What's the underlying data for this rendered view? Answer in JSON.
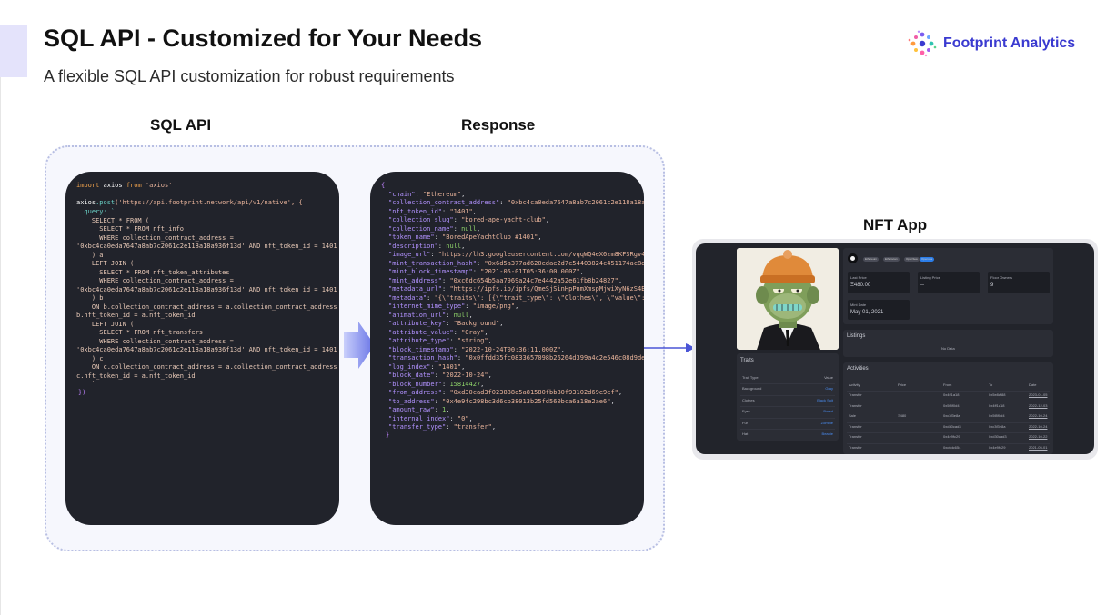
{
  "header": {
    "title": "SQL API - Customized for Your Needs",
    "subtitle": "A flexible SQL API customization for robust requirements"
  },
  "brand": {
    "name": "Footprint Analytics",
    "color": "#3a3ad0"
  },
  "columns": {
    "sql": "SQL API",
    "response": "Response",
    "app": "NFT App"
  },
  "code": {
    "import": {
      "kw1": "import",
      "name": "axios",
      "kw2": "from",
      "str": "'axios'"
    },
    "call": {
      "obj": "axios",
      "method": ".post",
      "url": "('https://api.footprint.network/api/v1/native', {"
    },
    "query_key": "  query: `",
    "sql_lines": [
      "    SELECT * FROM (",
      "      SELECT * FROM nft_info",
      "      WHERE collection_contract_address =",
      "'0xbc4ca0eda7647a8ab7c2061c2e118a18a936f13d' AND nft_token_id = 1401",
      "    ) a",
      "    LEFT JOIN (",
      "      SELECT * FROM nft_token_attributes",
      "      WHERE collection_contract_address =",
      "'0xbc4ca0eda7647a8ab7c2061c2e118a18a936f13d' AND nft_token_id = 1401",
      "    ) b",
      "    ON b.collection_contract_address = a.collection_contract_address AND",
      "b.nft_token_id = a.nft_token_id",
      "    LEFT JOIN (",
      "      SELECT * FROM nft_transfers",
      "      WHERE collection_contract_address =",
      "'0xbc4ca0eda7647a8ab7c2061c2e118a18a936f13d' AND nft_token_id = 1401",
      "    ) c",
      "    ON c.collection_contract_address = a.collection_contract_address AND",
      "c.nft_token_id = a.nft_token_id",
      "    `"
    ],
    "close": "})"
  },
  "response": {
    "open": "{",
    "close": "}",
    "rows": [
      {
        "key": "\"chain\"",
        "val": "\"Ethereum\"",
        "type": "str"
      },
      {
        "key": "\"collection_contract_address\"",
        "val": "\"0xbc4ca0eda7647a8ab7c2061c2e118a18a936f",
        "type": "str"
      },
      {
        "key": "\"nft_token_id\"",
        "val": "\"1401\"",
        "type": "str"
      },
      {
        "key": "\"collection_slug\"",
        "val": "\"bored-ape-yacht-club\"",
        "type": "str"
      },
      {
        "key": "\"collection_name\"",
        "val": "null",
        "type": "num"
      },
      {
        "key": "\"token_name\"",
        "val": "\"BoredApeYachtClub #1401\"",
        "type": "str"
      },
      {
        "key": "\"description\"",
        "val": "null",
        "type": "num"
      },
      {
        "key": "\"image_url\"",
        "val": "\"https://lh3.googleusercontent.com/vqqWQ4eX6zm8KFSRgv4-K6",
        "type": "str"
      },
      {
        "key": "\"mint_transaction_hash\"",
        "val": "\"0x6d5a377ad620edae2d7c54403824c451174ac8dd",
        "type": "str"
      },
      {
        "key": "\"mint_block_timestamp\"",
        "val": "\"2021-05-01T05:36:00.000Z\"",
        "type": "str"
      },
      {
        "key": "\"mint_address\"",
        "val": "\"0xc6dc654b5aa7969a24c7e4442a52e61fb8b24827\"",
        "type": "str"
      },
      {
        "key": "\"metadata_url\"",
        "val": "\"https://ipfs.io/ipfs/QmeSjSinHpPnmXmspMjwiXyN6zS4E9zcca",
        "type": "str"
      },
      {
        "key": "\"metadata\"",
        "val": "\"{\\\"traits\\\": [{\\\"trait_type\\\": \\\"Clothes\\\", \\\"value\\\": \\\"Black Suit\\\"",
        "type": "str"
      },
      {
        "key": "\"internet_mime_type\"",
        "val": "\"image/png\"",
        "type": "str"
      },
      {
        "key": "\"animation_url\"",
        "val": "null",
        "type": "num"
      },
      {
        "key": "\"attribute_key\"",
        "val": "\"Background\"",
        "type": "str"
      },
      {
        "key": "\"attribute_value\"",
        "val": "\"Gray\"",
        "type": "str"
      },
      {
        "key": "\"attribute_type\"",
        "val": "\"string\"",
        "type": "str"
      },
      {
        "key": "\"block_timestamp\"",
        "val": "\"2022-10-24T00:36:11.000Z\"",
        "type": "str"
      },
      {
        "key": "\"transaction_hash\"",
        "val": "\"0x0ffdd35fc0833657098b26264d399a4c2e546c08d9de0b",
        "type": "str"
      },
      {
        "key": "\"log_index\"",
        "val": "\"1401\"",
        "type": "str"
      },
      {
        "key": "\"block_date\"",
        "val": "\"2022-10-24\"",
        "type": "str"
      },
      {
        "key": "\"block_number\"",
        "val": "15814427",
        "type": "num"
      },
      {
        "key": "\"from_address\"",
        "val": "\"0xd30cad3f023888d5a81580fbb80f93102d69e9ef\"",
        "type": "str"
      },
      {
        "key": "\"to_address\"",
        "val": "\"0x4e9fc298bc3d6cb38013b25fd560bca6a18e2ae6\"",
        "type": "str"
      },
      {
        "key": "\"amount_raw\"",
        "val": "1",
        "type": "num"
      },
      {
        "key": "\"internal_index\"",
        "val": "\"0\"",
        "type": "str"
      },
      {
        "key": "\"transfer_type\"",
        "val": "\"transfer\"",
        "type": "str"
      }
    ]
  },
  "nft_app": {
    "chips": [
      "Ethereum",
      "Etherscan",
      "OpenSea",
      "Opensea"
    ],
    "stats": [
      {
        "label": "Last Price",
        "value": "Ξ480.00"
      },
      {
        "label": "Listing Price",
        "value": "--"
      },
      {
        "label": "Floor Owners",
        "value": "9"
      }
    ],
    "mint_date": {
      "label": "Mint Date",
      "value": "May 01, 2021"
    },
    "listings": {
      "title": "Listings",
      "empty": "No Data"
    },
    "traits": {
      "title": "Traits",
      "header": [
        "Trait Type",
        "Value"
      ],
      "rows": [
        {
          "type": "Background",
          "value": "Gray"
        },
        {
          "type": "Clothes",
          "value": "Black Suit"
        },
        {
          "type": "Eyes",
          "value": "Bored"
        },
        {
          "type": "Fur",
          "value": "Zombie"
        },
        {
          "type": "Hat",
          "value": "Beanie"
        }
      ]
    },
    "activities": {
      "title": "Activities",
      "header": [
        "Activity",
        "Price",
        "From",
        "To",
        "Date"
      ],
      "rows": [
        {
          "activity": "Transfer",
          "price": "",
          "from": "0x4ff1a18",
          "to": "0x5e8cf88",
          "date": "2023-01-05"
        },
        {
          "activity": "Transfer",
          "price": "",
          "from": "0x5f8f0d4",
          "to": "0x4ff1a18",
          "date": "2022-12-03"
        },
        {
          "activity": "Sale",
          "price": "Ξ480",
          "from": "0xc3f3e8a",
          "to": "0x5f8f0d4",
          "date": "2022-10-24"
        },
        {
          "activity": "Transfer",
          "price": "",
          "from": "0xd30cad3",
          "to": "0xc3f3e8a",
          "date": "2022-10-24"
        },
        {
          "activity": "Transfer",
          "price": "",
          "from": "0x4e9fc29",
          "to": "0xd30cad3",
          "date": "2022-10-22"
        },
        {
          "activity": "Transfer",
          "price": "",
          "from": "0xc6dc654",
          "to": "0x4e9fc29",
          "date": "2021-05-01"
        }
      ]
    }
  }
}
